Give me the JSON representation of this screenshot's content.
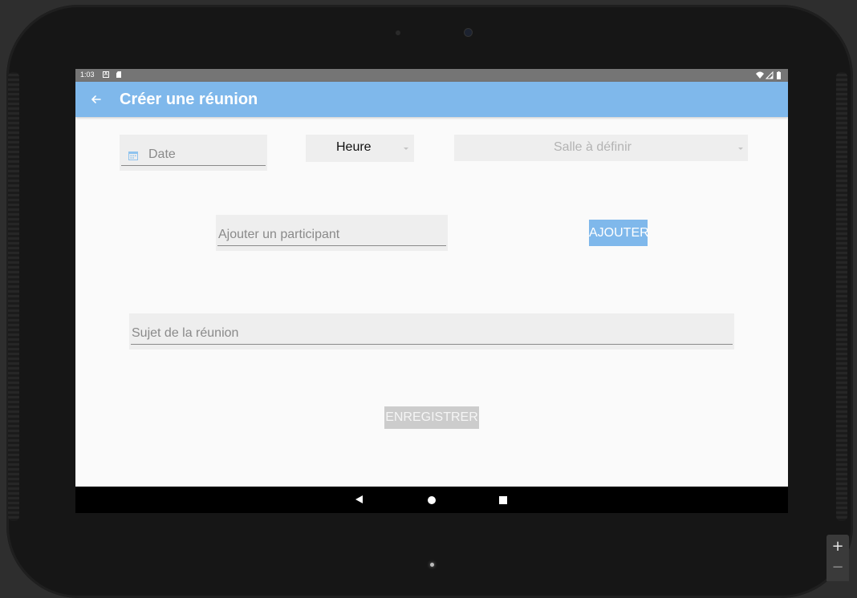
{
  "status_bar": {
    "time": "1:03",
    "notification_icon_a": "A"
  },
  "app_bar": {
    "title": "Créer une réunion"
  },
  "form": {
    "date_placeholder": "Date",
    "heure_label": "Heure",
    "salle_label": "Salle à définir",
    "participant_placeholder": "Ajouter un participant",
    "ajouter_label": "AJOUTER",
    "sujet_placeholder": "Sujet de la réunion",
    "enregistrer_label": "ENREGISTRER"
  },
  "emulator": {
    "zoom_in_label": "+",
    "zoom_out_label": "−"
  },
  "colors": {
    "accent": "#7fb8eb",
    "status_bar": "#757575",
    "field_background": "#eeeeee",
    "disabled_button": "#cccccc"
  }
}
